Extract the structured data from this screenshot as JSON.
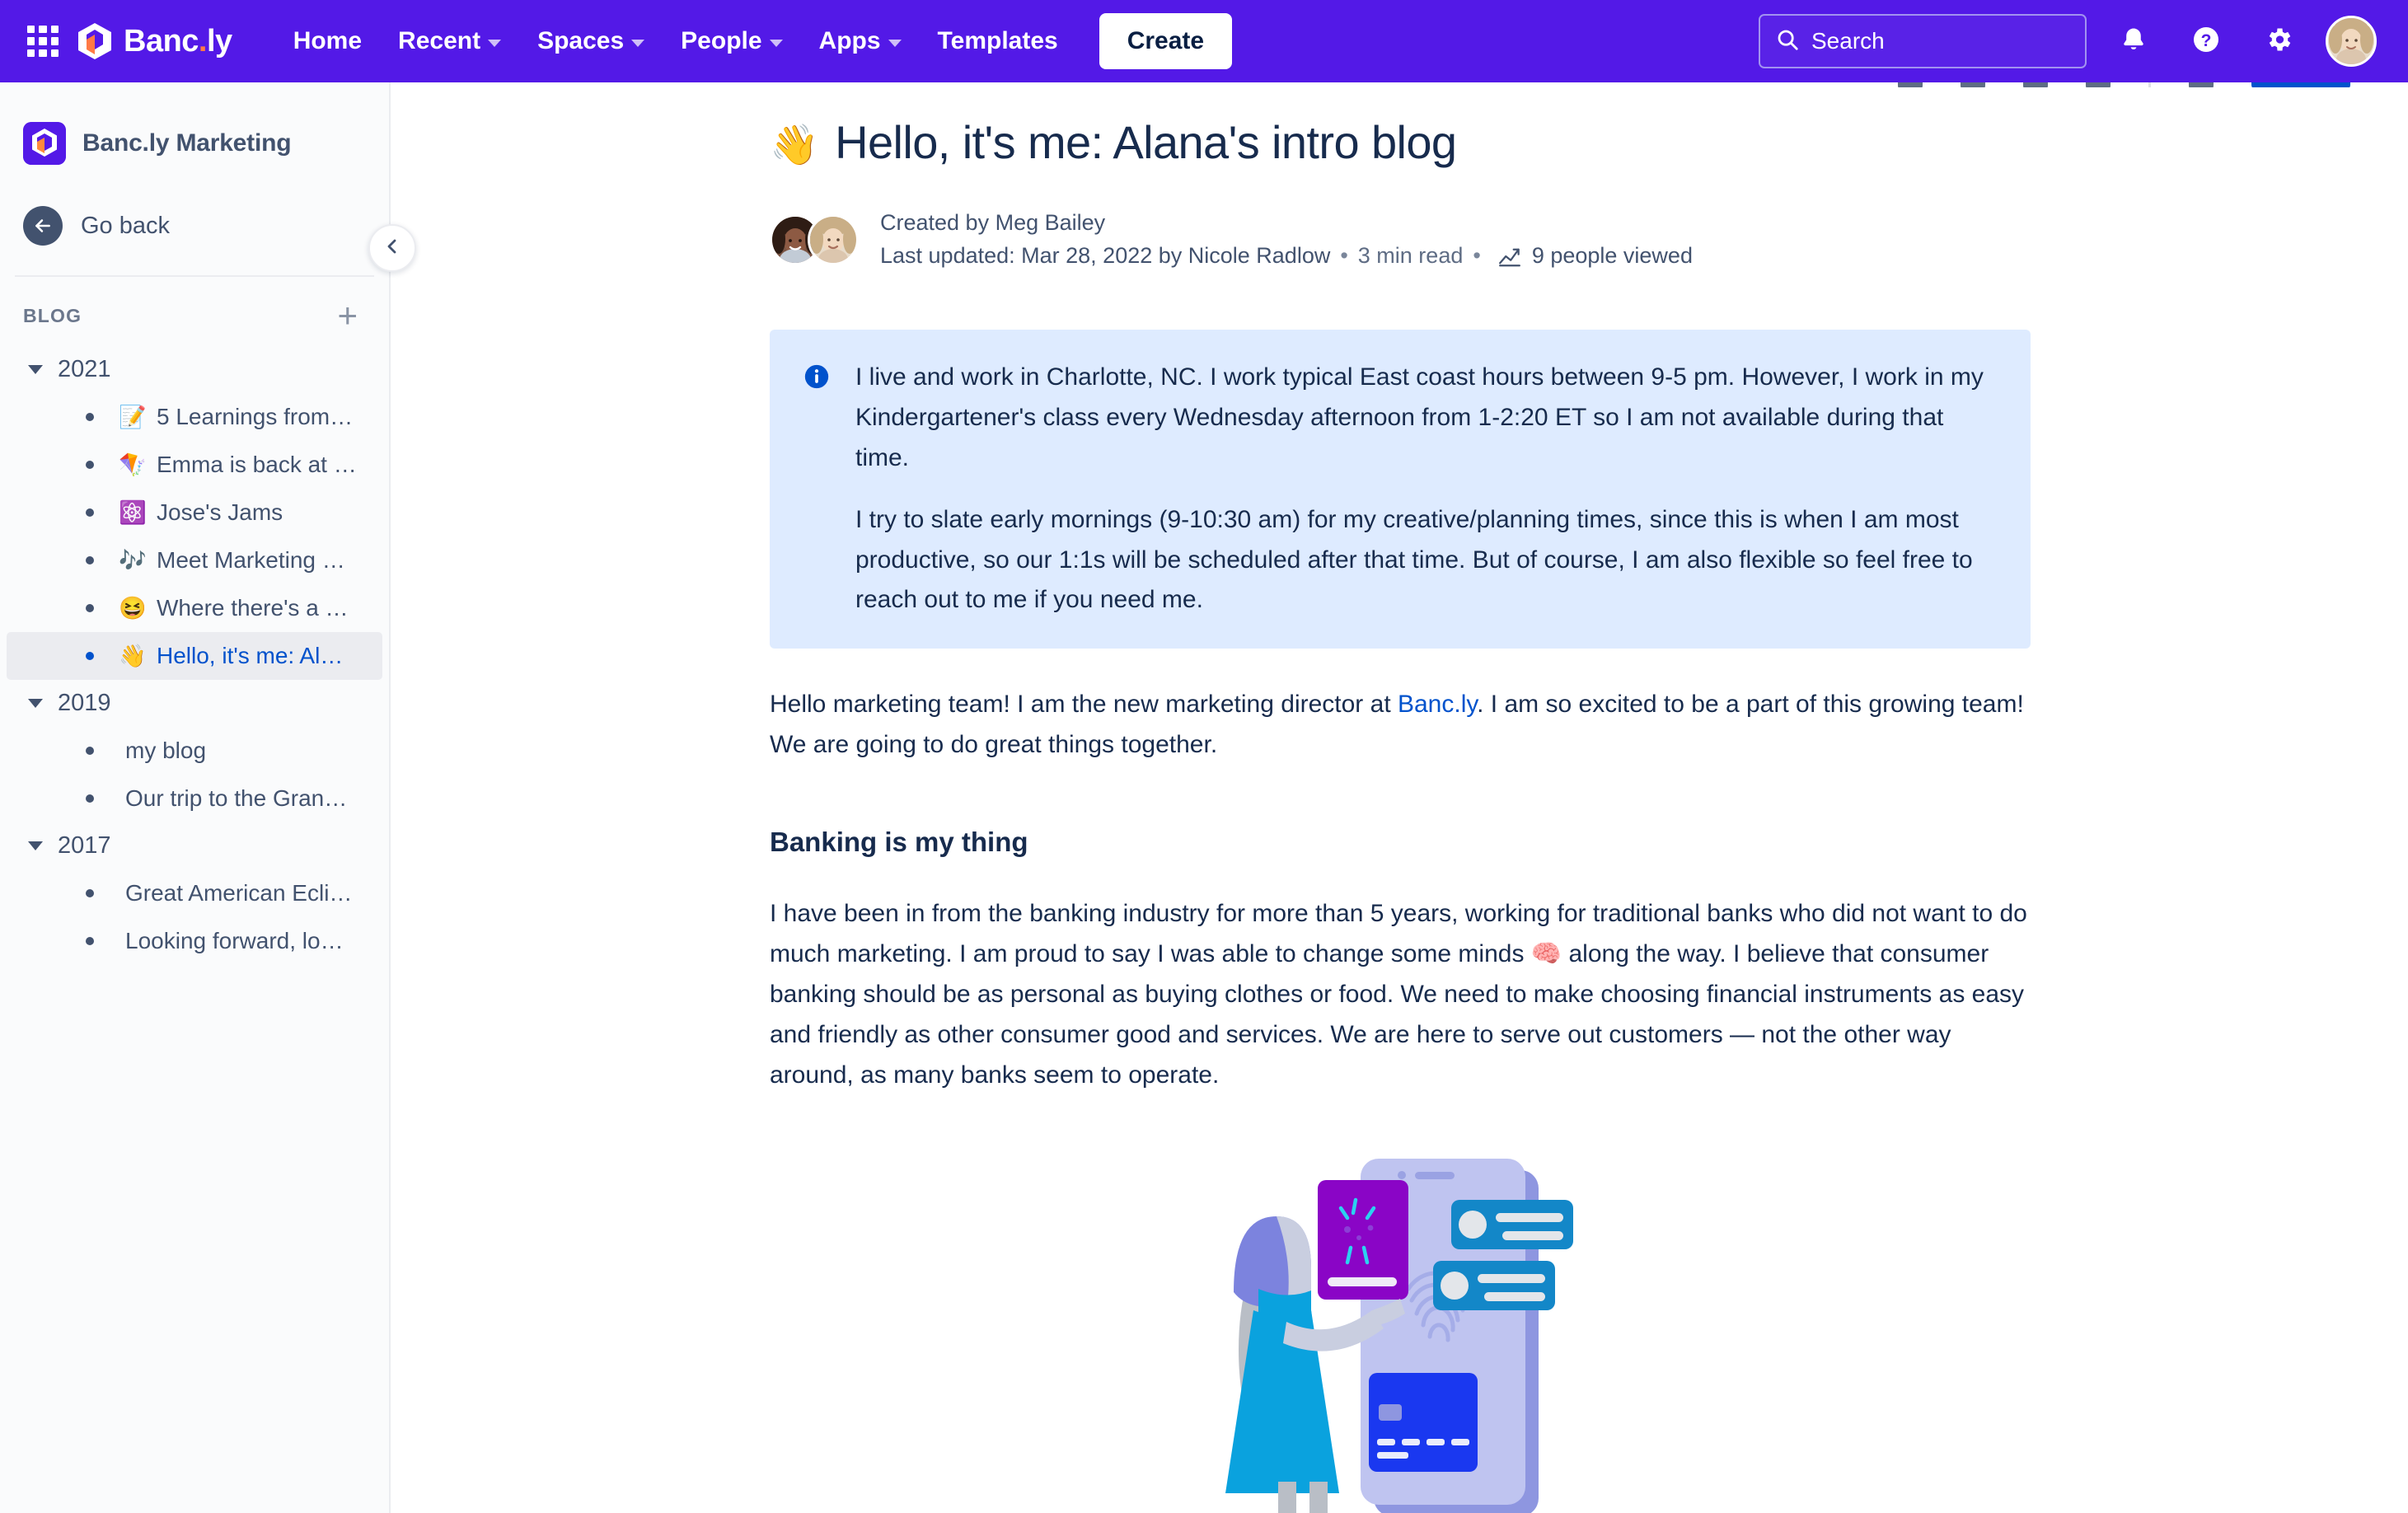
{
  "topnav": {
    "brand": {
      "name": "Banc",
      "suffix": "ly",
      "dot": "."
    },
    "items": [
      {
        "label": "Home",
        "has_caret": false
      },
      {
        "label": "Recent",
        "has_caret": true
      },
      {
        "label": "Spaces",
        "has_caret": true
      },
      {
        "label": "People",
        "has_caret": true
      },
      {
        "label": "Apps",
        "has_caret": true
      },
      {
        "label": "Templates",
        "has_caret": false
      }
    ],
    "create_label": "Create",
    "search": {
      "value": "",
      "placeholder": "Search",
      "display": "Search"
    },
    "icons": {
      "app_switcher": "grid-icon",
      "notifications": "bell-icon",
      "help": "question-circle-icon",
      "settings": "gear-icon",
      "profile": "avatar"
    }
  },
  "sidebar": {
    "space_title": "Banc.ly Marketing",
    "go_back": "Go back",
    "section_title": "BLOG",
    "add_label": "+",
    "tree": [
      {
        "year": "2021",
        "expanded": true,
        "children": [
          {
            "emoji": "📝",
            "label": "5 Learnings from…",
            "active": false
          },
          {
            "emoji": "🪁",
            "label": "Emma is back at …",
            "active": false
          },
          {
            "emoji": "⚛️",
            "label": "Jose's Jams",
            "active": false
          },
          {
            "emoji": "🎶",
            "label": "Meet Marketing …",
            "active": false
          },
          {
            "emoji": "😆",
            "label": "Where there's a …",
            "active": false
          },
          {
            "emoji": "👋",
            "label": "Hello, it's me: Al…",
            "active": true
          }
        ]
      },
      {
        "year": "2019",
        "expanded": true,
        "children": [
          {
            "emoji": "",
            "label": "my blog",
            "active": false
          },
          {
            "emoji": "",
            "label": "Our trip to the Gran…",
            "active": false
          }
        ]
      },
      {
        "year": "2017",
        "expanded": true,
        "children": [
          {
            "emoji": "",
            "label": "Great American Ecli…",
            "active": false
          },
          {
            "emoji": "",
            "label": "Looking forward, lo…",
            "active": false
          }
        ]
      }
    ]
  },
  "document": {
    "title_emoji": "👋",
    "title": "Hello, it's me: Alana's intro blog",
    "created_by": "Created by Meg Bailey",
    "last_updated": "Last updated: Mar 28, 2022 by Nicole Radlow",
    "read_time": "3 min read",
    "views": "9 people viewed",
    "separator": "•",
    "info_panel": {
      "icon": "info-icon",
      "paragraphs": [
        "I live and work in Charlotte, NC. I work typical East coast hours between 9-5 pm. However, I work in my Kindergartener's class every Wednesday afternoon from 1-2:20 ET so I am not available during that time.",
        "I try to slate early mornings (9-10:30 am) for my creative/planning times, since this is when I am most productive, so our 1:1s will be scheduled after that time. But of course, I am also flexible so feel free to reach out to me if you need me."
      ]
    },
    "intro_before_link": "Hello marketing team! I am the new marketing director at ",
    "intro_link": "Banc.ly",
    "intro_after_link": ". I am so excited to be a part of this growing team! We are going to do great things together.",
    "heading_banking": "Banking is my thing",
    "banking_para_1": "I have been in from the banking industry for more than 5 years, working for traditional banks who did not want to do much marketing. I am proud to say I was able to change some minds ",
    "banking_emoji": "🧠",
    "banking_para_2": " along the way. I believe that consumer banking should be as personal as buying clothes or food. We need to make choosing financial instruments as easy and friendly as other consumer good and services. We are here to serve out customers — not the other way around, as many banks seem to operate.",
    "illustration_alt": "woman-with-phone-banking-illustration"
  },
  "colors": {
    "nav_purple": "#5319E7",
    "sidebar_bg": "#FAFBFC",
    "info_panel_bg": "#DEEBFF",
    "link_blue": "#0052CC",
    "text_dark": "#172B4D",
    "text_muted": "#42526E",
    "brand_orange": "#FF7A45"
  }
}
